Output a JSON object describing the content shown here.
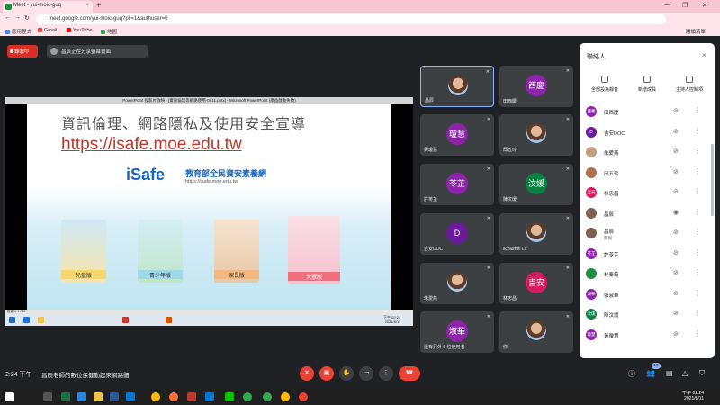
{
  "browser": {
    "tab_title": "Meet - yui-moic-guq",
    "new_tab": "+",
    "url": "meet.google.com/yui-moic-guq?pli=1&authuser=0",
    "bookmarks": [
      "應用程式",
      "Gmail",
      "YouTube",
      "地圖"
    ],
    "reading_list": "閱讀清單"
  },
  "meet": {
    "recording_label": "錄製中",
    "presenting_label": "昌辰正在分享螢幕畫面",
    "slide": {
      "window_title": "PowerPoint 投影片放映 - [資訊倫理等網路使用-0011.pptx] - Microsoft PowerPoint (產品啟動失敗)",
      "title": "資訊倫理、網路隱私及使用安全宣導",
      "link": "https://isafe.moe.edu.tw",
      "brand": "iSafe",
      "brand_title": "教育部全民資安素養網",
      "brand_url": "https://isafe.moe.edu.tw",
      "cards": [
        "兒童版",
        "青少年版",
        "家長版",
        "大眾版"
      ],
      "status": "投影片 1 / 10",
      "tray_time": "下午 02:24",
      "tray_date": "2021/8/11"
    },
    "tiles": [
      {
        "name": "昌辰",
        "initial": "",
        "color": "#3c4043"
      },
      {
        "name": "田西慶",
        "initial": "西慶",
        "color": "#8e24aa"
      },
      {
        "name": "黃瓊慧",
        "initial": "瓊慧",
        "color": "#8e24aa"
      },
      {
        "name": "邱五玲",
        "initial": "",
        "color": "#3c4043"
      },
      {
        "name": "許苓芷",
        "initial": "苓芷",
        "color": "#8e24aa"
      },
      {
        "name": "陳汶煖",
        "initial": "汶煖",
        "color": "#0b8043"
      },
      {
        "name": "吉安DOC",
        "initial": "D",
        "color": "#6a1b9a"
      },
      {
        "name": "lichiumei Lu",
        "initial": "",
        "color": "#3c4043"
      },
      {
        "name": "朱愛燕",
        "initial": "",
        "color": "#3c4043"
      },
      {
        "name": "林忠昌",
        "initial": "吉安",
        "color": "#d81b60"
      },
      {
        "name": "還有另外 6 位使用者",
        "initial": "淑華",
        "color": "#8e24aa"
      },
      {
        "name": "你",
        "initial": "",
        "color": "#3c4043"
      }
    ],
    "bottom": {
      "time": "2:24 下午",
      "meeting_name": "昌辰老師的數位保健動起來網路體"
    }
  },
  "panel": {
    "title": "聯絡人",
    "close": "×",
    "actions": [
      "全部設為靜音",
      "新增成員",
      "主持人控制項"
    ],
    "people": [
      {
        "name": "田西慶",
        "sub": "",
        "initial": "西慶",
        "color": "#8e24aa",
        "mic": "off"
      },
      {
        "name": "吉安DOC",
        "sub": "",
        "initial": "D",
        "color": "#6a1b9a",
        "mic": "off"
      },
      {
        "name": "朱愛燕",
        "sub": "",
        "initial": "",
        "color": "#c0a080",
        "mic": "off"
      },
      {
        "name": "邱五玲",
        "sub": "",
        "initial": "",
        "color": "#b07050",
        "mic": "off"
      },
      {
        "name": "林忠昌",
        "sub": "",
        "initial": "吉安",
        "color": "#d81b60",
        "mic": "off"
      },
      {
        "name": "昌辰",
        "sub": "",
        "initial": "",
        "color": "#806050",
        "mic": "on"
      },
      {
        "name": "昌辰",
        "sub": "簡報",
        "initial": "",
        "color": "#806050",
        "mic": "off"
      },
      {
        "name": "許苓芷",
        "sub": "",
        "initial": "苓芷",
        "color": "#8e24aa",
        "mic": "off"
      },
      {
        "name": "林秦筠",
        "sub": "",
        "initial": "",
        "color": "#1e8e3e",
        "mic": "off"
      },
      {
        "name": "張淑華",
        "sub": "",
        "initial": "淑華",
        "color": "#8e24aa",
        "mic": "off"
      },
      {
        "name": "陳汶煖",
        "sub": "",
        "initial": "汶煖",
        "color": "#0b8043",
        "mic": "off"
      },
      {
        "name": "黃瓊慧",
        "sub": "",
        "initial": "瓊慧",
        "color": "#8e24aa",
        "mic": "off"
      }
    ],
    "participant_count": "18"
  },
  "taskbar": {
    "time": "下午 02:24",
    "date": "2021/8/11"
  }
}
